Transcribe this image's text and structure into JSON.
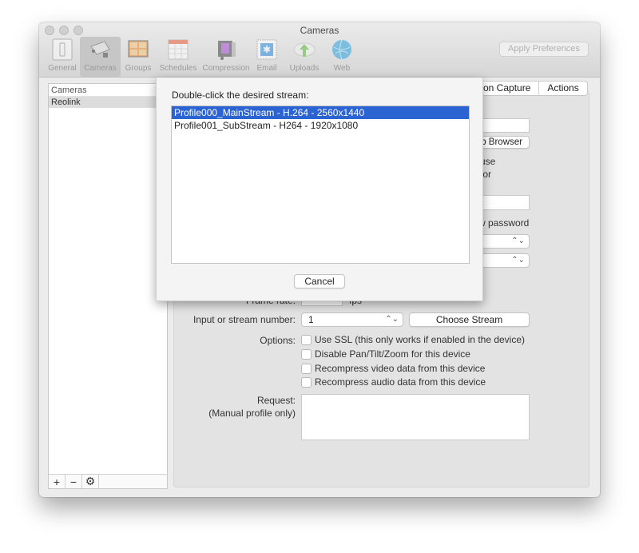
{
  "window": {
    "title": "Cameras",
    "apply_label": "Apply Preferences"
  },
  "toolbar": {
    "items": [
      {
        "label": "General",
        "icon": "switch-icon",
        "active": false
      },
      {
        "label": "Cameras",
        "icon": "camera-icon",
        "active": true
      },
      {
        "label": "Groups",
        "icon": "grid-icon",
        "active": false
      },
      {
        "label": "Schedules",
        "icon": "calendar-icon",
        "active": false
      },
      {
        "label": "Compression",
        "icon": "film-icon",
        "active": false
      },
      {
        "label": "Email",
        "icon": "stamp-icon",
        "active": false
      },
      {
        "label": "Uploads",
        "icon": "cloud-upload-icon",
        "active": false
      },
      {
        "label": "Web",
        "icon": "globe-icon",
        "active": false
      }
    ]
  },
  "sidebar": {
    "header": "Cameras",
    "items": [
      "Reolink"
    ],
    "footer": {
      "add": "+",
      "remove": "−",
      "settings": "⚙"
    }
  },
  "tabs": [
    "on Capture",
    "Actions"
  ],
  "form": {
    "web_browser_label": "b Browser",
    "use_text_1": "use",
    "use_text_2": "for",
    "password_text": "w password",
    "frame_rate_label": "Frame rate:",
    "fps_label": "fps",
    "stream_number_label": "Input or stream number:",
    "stream_number_value": "1",
    "choose_stream_label": "Choose Stream",
    "options_label": "Options:",
    "options": [
      {
        "label": "Use SSL (this only works if enabled in the device)",
        "checked": false
      },
      {
        "label": "Disable Pan/Tilt/Zoom for this device",
        "checked": false
      },
      {
        "label": "Recompress video data from this device",
        "checked": false
      },
      {
        "label": "Recompress audio data from this device",
        "checked": false
      }
    ],
    "request_label": "Request:",
    "request_sublabel": "(Manual profile only)",
    "request_value": ""
  },
  "sheet": {
    "prompt": "Double-click the desired stream:",
    "streams": [
      {
        "label": "Profile000_MainStream - H.264 - 2560x1440",
        "selected": true
      },
      {
        "label": "Profile001_SubStream - H264 - 1920x1080",
        "selected": false
      }
    ],
    "cancel_label": "Cancel"
  }
}
